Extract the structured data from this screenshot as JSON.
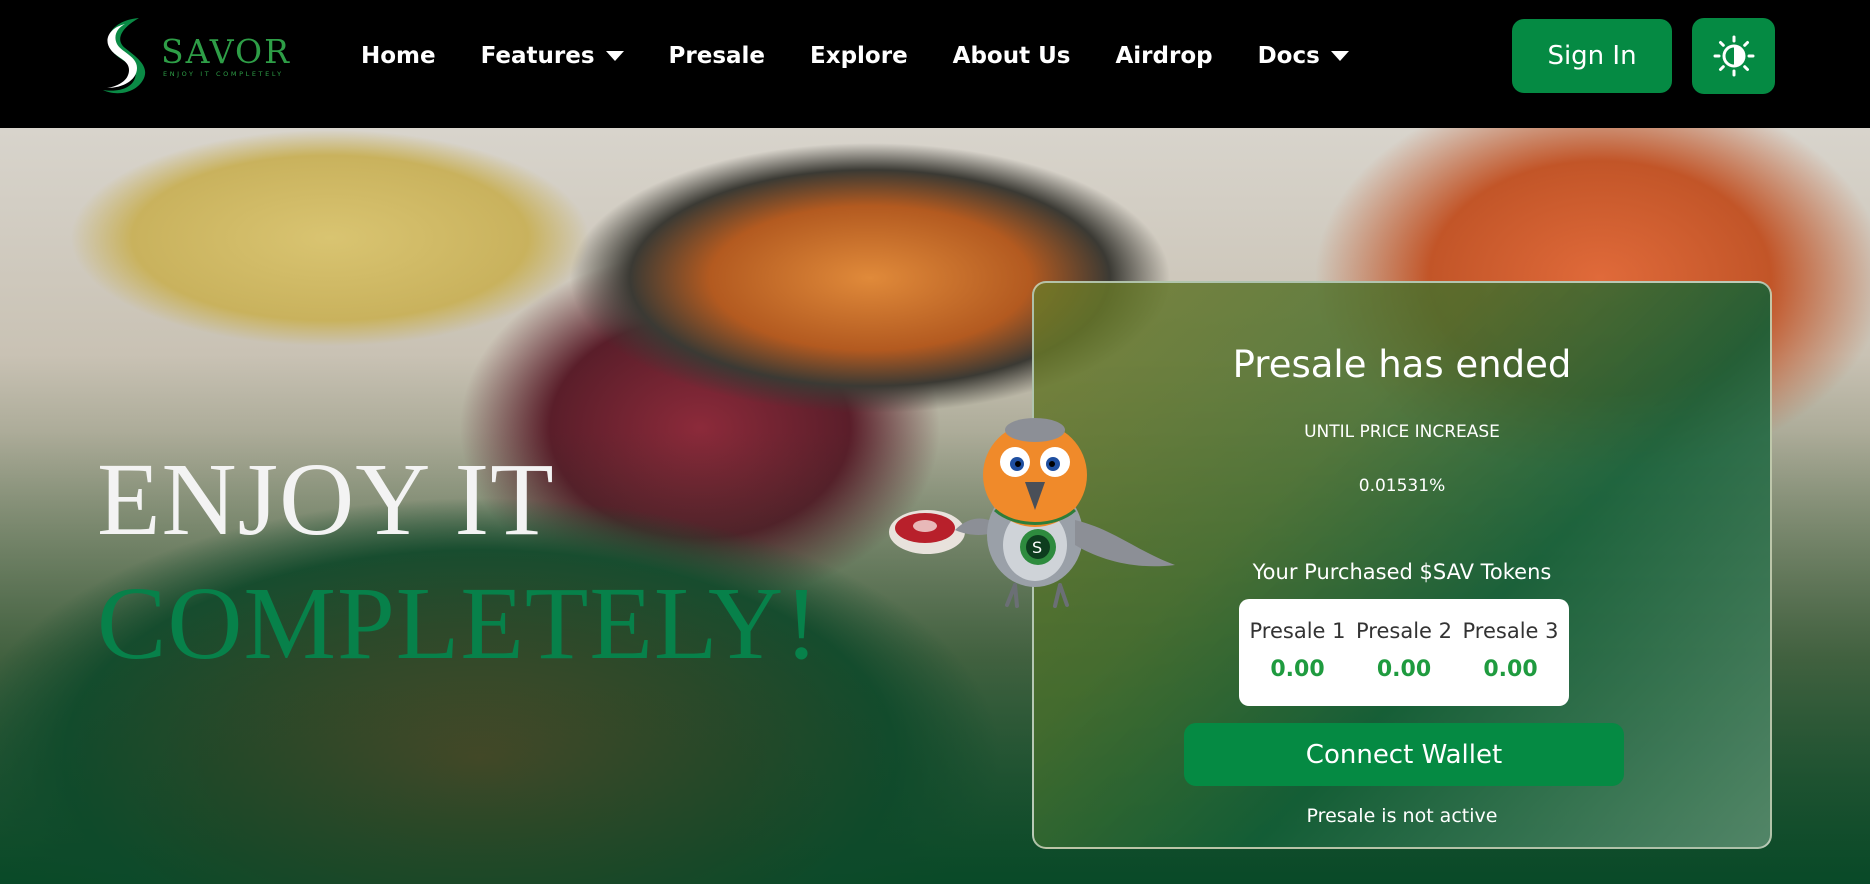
{
  "brand": {
    "name": "SAVOR",
    "tagline": "ENJOY IT COMPLETELY",
    "logo_icon": "savor-s-logo",
    "accent": "#058a43"
  },
  "nav": {
    "items": [
      {
        "label": "Home",
        "dropdown": false
      },
      {
        "label": "Features",
        "dropdown": true
      },
      {
        "label": "Presale",
        "dropdown": false
      },
      {
        "label": "Explore",
        "dropdown": false
      },
      {
        "label": "About Us",
        "dropdown": false
      },
      {
        "label": "Airdrop",
        "dropdown": false
      },
      {
        "label": "Docs",
        "dropdown": true
      }
    ],
    "signin_label": "Sign In",
    "theme_icon": "sun-icon"
  },
  "hero": {
    "line1": "ENJOY IT",
    "line2": "COMPLETELY!"
  },
  "presale": {
    "title": "Presale has ended",
    "until_label": "UNTIL PRICE INCREASE",
    "percent": "0.01531%",
    "purchased_label": "Your Purchased $SAV Tokens",
    "stages": [
      {
        "label": "Presale 1",
        "value": "0.00"
      },
      {
        "label": "Presale 2",
        "value": "0.00"
      },
      {
        "label": "Presale 3",
        "value": "0.00"
      }
    ],
    "connect_label": "Connect Wallet",
    "status": "Presale is not active"
  },
  "colors": {
    "green_button": "#058a43",
    "headline_green": "#07814a",
    "token_value": "#1f9b3f"
  }
}
